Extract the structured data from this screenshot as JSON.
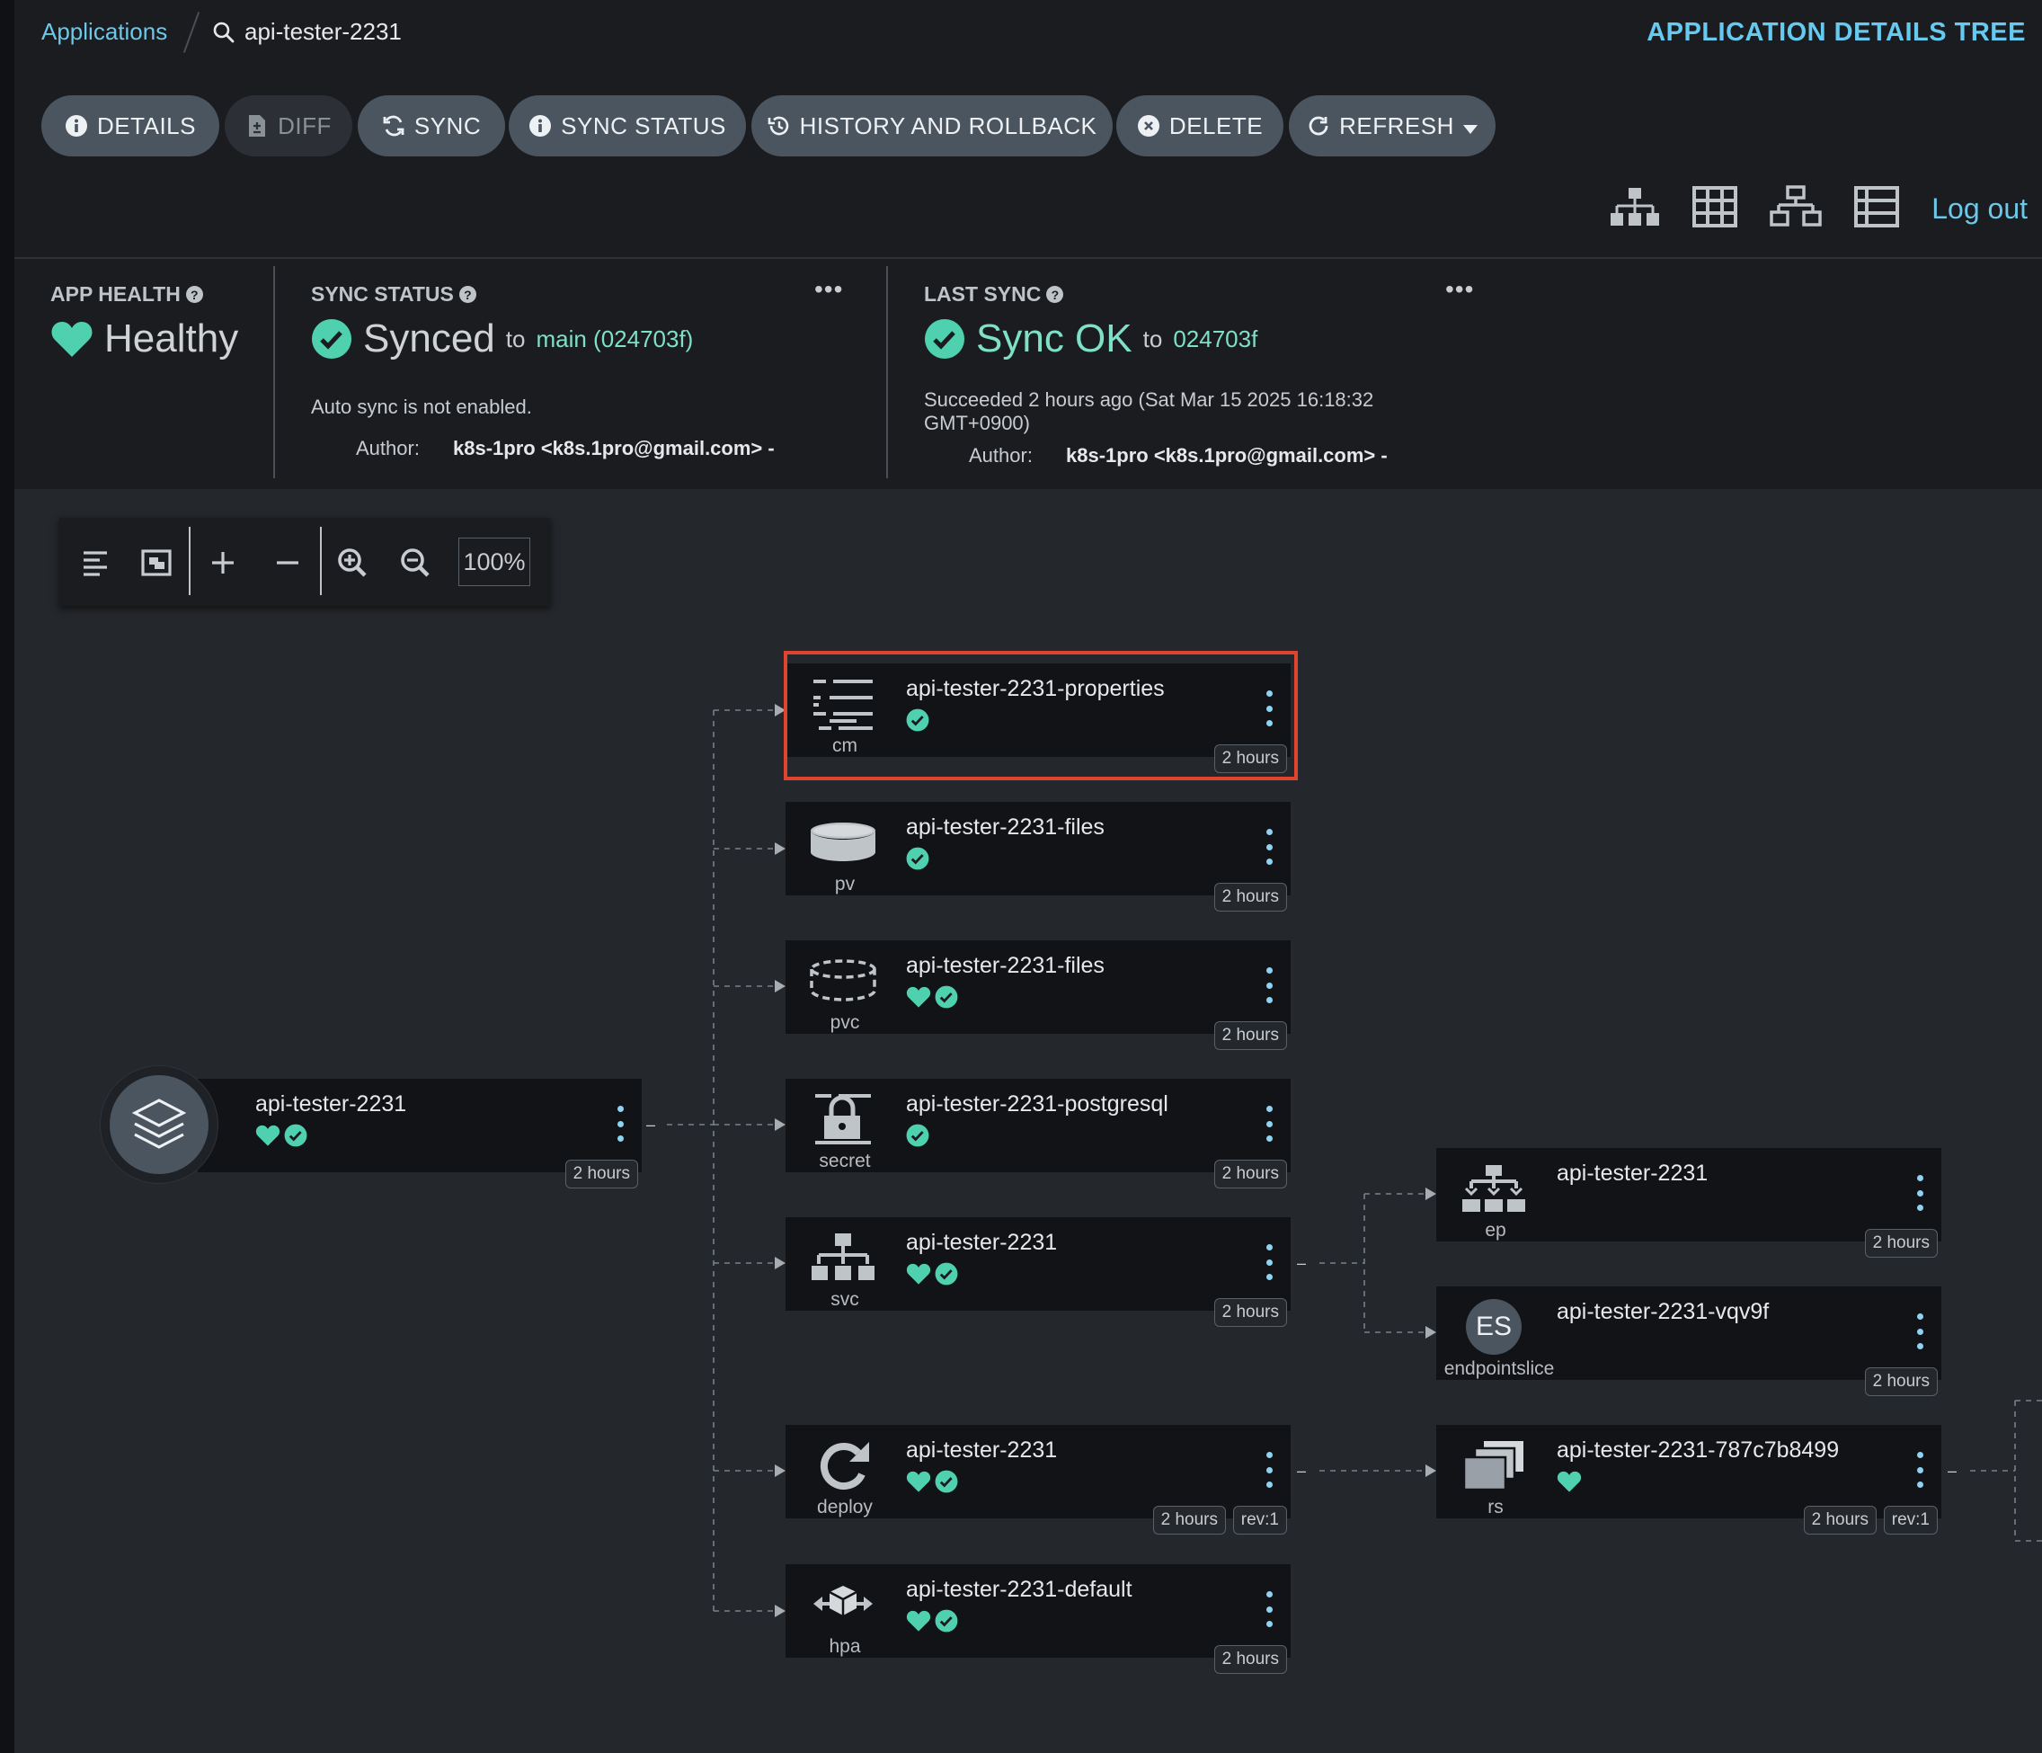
{
  "breadcrumb": {
    "applications": "Applications",
    "current": "api-tester-2231"
  },
  "header": {
    "title": "APPLICATION DETAILS TREE",
    "logout": "Log out"
  },
  "buttons": {
    "details": "DETAILS",
    "diff": "DIFF",
    "sync": "SYNC",
    "sync_status": "SYNC STATUS",
    "history": "HISTORY AND ROLLBACK",
    "delete": "DELETE",
    "refresh": "REFRESH"
  },
  "status": {
    "app_health": {
      "label": "APP HEALTH",
      "value": "Healthy"
    },
    "sync_status": {
      "label": "SYNC STATUS",
      "value": "Synced",
      "to_prefix": "to",
      "to_ref": "main (024703f)",
      "auto_sync": "Auto sync is not enabled.",
      "author_label": "Author:",
      "author": "k8s-1pro <k8s.1pro@gmail.com> -"
    },
    "last_sync": {
      "label": "LAST SYNC",
      "value": "Sync OK",
      "to_prefix": "to",
      "to_ref": "024703f",
      "succeeded": "Succeeded 2 hours ago (Sat Mar 15 2025 16:18:32",
      "succeeded2": "GMT+0900)",
      "author_label": "Author:",
      "author": "k8s-1pro <k8s.1pro@gmail.com> -"
    }
  },
  "zoom": {
    "level": "100%"
  },
  "root": {
    "name": "api-tester-2231",
    "age": "2 hours"
  },
  "nodes": [
    {
      "name": "api-tester-2231-properties",
      "kind": "cm",
      "age": "2 hours"
    },
    {
      "name": "api-tester-2231-files",
      "kind": "pv",
      "age": "2 hours"
    },
    {
      "name": "api-tester-2231-files",
      "kind": "pvc",
      "age": "2 hours"
    },
    {
      "name": "api-tester-2231-postgresql",
      "kind": "secret",
      "age": "2 hours"
    },
    {
      "name": "api-tester-2231",
      "kind": "svc",
      "age": "2 hours"
    },
    {
      "name": "api-tester-2231",
      "kind": "deploy",
      "age": "2 hours",
      "rev": "rev:1"
    },
    {
      "name": "api-tester-2231-default",
      "kind": "hpa",
      "age": "2 hours"
    },
    {
      "name": "api-tester-2231",
      "kind": "ep",
      "age": "2 hours"
    },
    {
      "name": "api-tester-2231-vqv9f",
      "kind": "endpointslice",
      "age": "2 hours",
      "icon_text": "ES"
    },
    {
      "name": "api-tester-2231-787c7b8499",
      "kind": "rs",
      "age": "2 hours",
      "rev": "rev:1"
    }
  ],
  "colors": {
    "healthy": "#18be94",
    "accent": "#6cc7e8",
    "highlight": "#e0442e"
  }
}
